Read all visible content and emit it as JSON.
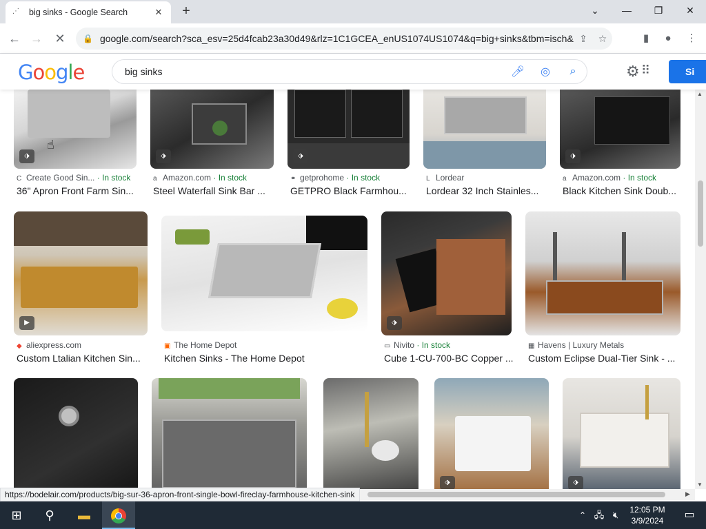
{
  "browser": {
    "tab_title": "big sinks - Google Search",
    "url": "google.com/search?sca_esv=25d4fcab23a30d49&rlz=1C1GCEA_enUS1074US1074&q=big+sinks&tbm=isch&so...",
    "status_url": "https://bodelair.com/products/big-sur-36-apron-front-single-bowl-fireclay-farmhouse-kitchen-sink"
  },
  "google": {
    "logo": "Google",
    "query": "big sinks",
    "signin_label": "Si"
  },
  "colors": {
    "stock_green": "#188038",
    "link_blue": "#1a73e8",
    "taskbar": "#1f2a36"
  },
  "results": {
    "row1": [
      {
        "source": "Create Good Sin...",
        "stock": "· In stock",
        "title": "36\" Apron Front Farm Sin...",
        "fav": "C",
        "badge": "tag-icon"
      },
      {
        "source": "Amazon.com",
        "stock": "· In stock",
        "title": "Steel Waterfall Sink Bar ...",
        "fav": "a",
        "badge": "tag-icon"
      },
      {
        "source": "getprohome",
        "stock": "· In stock",
        "title": "GETPRO Black Farmhou...",
        "fav": "⚭",
        "badge": "tag-icon"
      },
      {
        "source": "Lordear",
        "stock": "",
        "title": "Lordear 32 Inch Stainles...",
        "fav": "L",
        "badge": "tag-icon"
      },
      {
        "source": "Amazon.com",
        "stock": "· In stock",
        "title": "Black Kitchen Sink Doub...",
        "fav": "a",
        "badge": "tag-icon"
      }
    ],
    "row2": [
      {
        "source": "aliexpress.com",
        "stock": "",
        "title": "Custom Ltalian Kitchen Sin...",
        "fav": "◆",
        "badge": "play-icon"
      },
      {
        "source": "The Home Depot",
        "stock": "",
        "title": "Kitchen Sinks - The Home Depot",
        "fav": "▣",
        "badge": ""
      },
      {
        "source": "Nivito",
        "stock": "· In stock",
        "title": "Cube 1-CU-700-BC Copper ...",
        "fav": "▭",
        "badge": "tag-icon"
      },
      {
        "source": "Havens | Luxury Metals",
        "stock": "",
        "title": "Custom Eclipse Dual-Tier Sink - ...",
        "fav": "▦",
        "badge": ""
      }
    ]
  },
  "taskbar": {
    "time": "12:05 PM",
    "date": "3/9/2024"
  }
}
